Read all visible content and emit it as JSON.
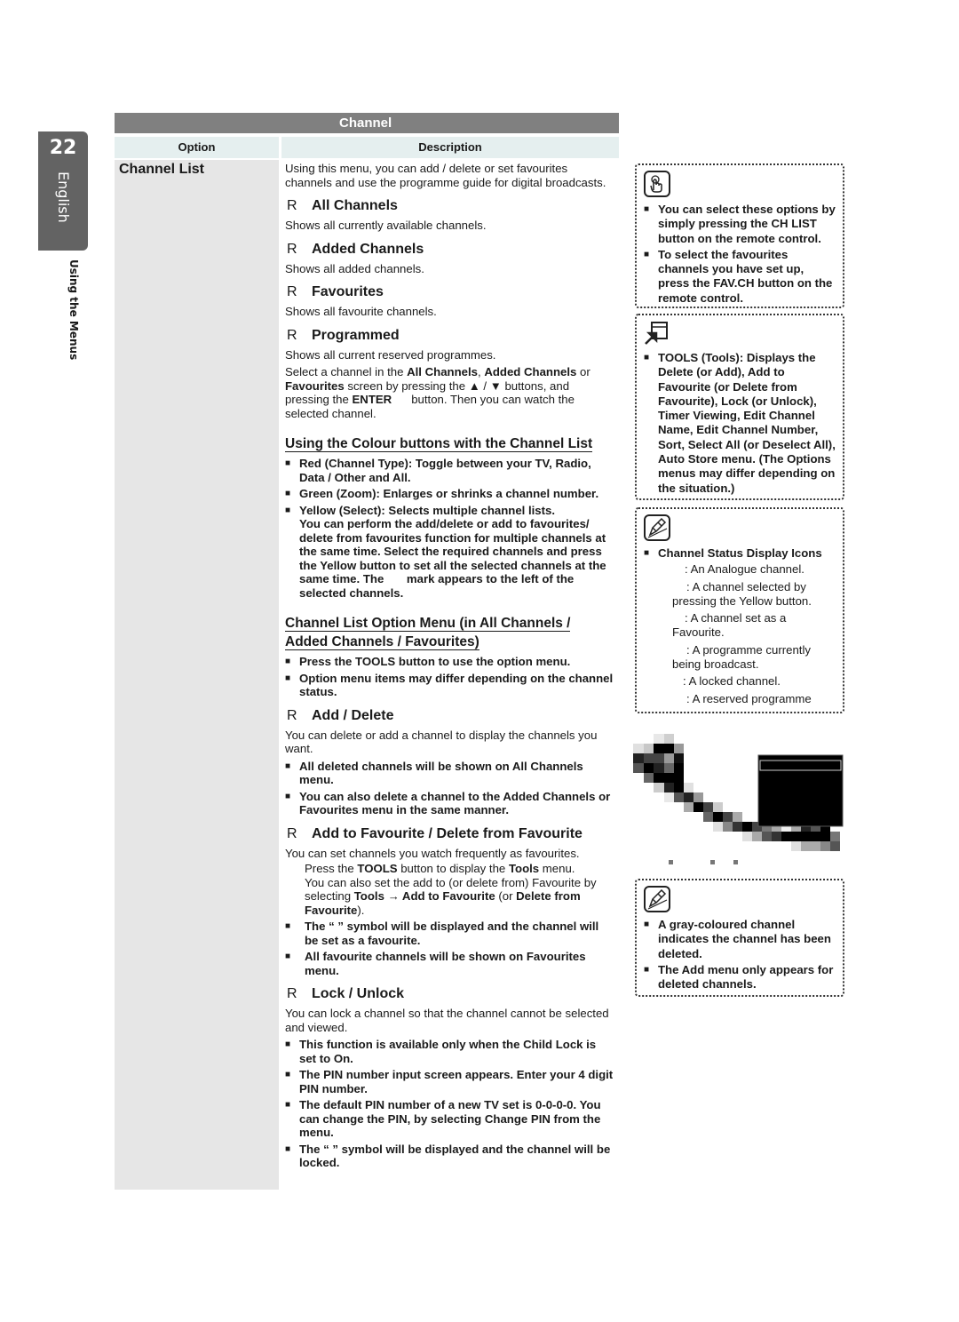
{
  "side_tab": {
    "page_number": "22",
    "language": "English",
    "section": "Using the Menus"
  },
  "table": {
    "title": "Channel",
    "header_option": "Option",
    "header_description": "Description",
    "option_name": "Channel List"
  },
  "desc": {
    "intro": "Using this menu, you can add / delete or set favourites channels and use the programme guide for digital broadcasts.",
    "marker": "R",
    "all_channels": {
      "title": "All Channels",
      "text": "Shows all currently available channels."
    },
    "added_channels": {
      "title": "Added Channels",
      "text": "Shows all added channels."
    },
    "favourites": {
      "title": "Favourites",
      "text": "Shows all favourite channels."
    },
    "programmed": {
      "title": "Programmed",
      "text": "Shows all current reserved programmes.",
      "select_a": "Select a channel in the ",
      "select_b1": "All Channels",
      "select_c": ", ",
      "select_b2": "Added Channels",
      "select_d": " or ",
      "select_b3": "Favourites",
      "select_e": " screen by pressing the ▲ / ▼ buttons, and pressing the ",
      "select_b4": "ENTER",
      "select_f": "      button. Then you can watch the selected channel."
    },
    "colour_heading": "Using the Colour buttons with the Channel List",
    "colour_items": {
      "red_a": "Red (",
      "red_b": "Channel Type",
      "red_c": "): Toggle between your ",
      "red_d": "TV",
      "red_e": ", ",
      "red_f": "Radio",
      "red_g": ", ",
      "red_h": "Data / Other",
      "red_i": " and ",
      "red_j": "All",
      "red_k": ".",
      "green_a": "Green (",
      "green_b": "Zoom",
      "green_c": "): Enlarges or shrinks a channel number.",
      "yellow_a": "Yellow (",
      "yellow_b": "Select",
      "yellow_c": "): Selects multiple channel lists.",
      "yellow_d": "You can perform the add/delete or add to favourites/ delete from favourites function for multiple channels at the same time. Select the required channels and press the Yellow button to set all the selected channels at the same time. The       mark appears to the left of the selected channels."
    },
    "option_menu_heading_1": "Channel List Option Menu (in All Channels /",
    "option_menu_heading_2": "Added Channels / Favourites)",
    "option_menu_items": {
      "tools_a": "Press the ",
      "tools_b": "TOOLS",
      "tools_c": " button to use the option menu.",
      "differ": "Option menu items may differ depending on the channel status."
    },
    "add_delete": {
      "title": "Add / Delete",
      "text": "You can delete or add a channel to display the channels you want.",
      "item1_a": "All deleted channels will be shown on ",
      "item1_b": "All Channels",
      "item1_c": " menu.",
      "item2_a": "You can also delete a channel to the ",
      "item2_b": "Added Channels",
      "item2_c": " or ",
      "item2_d": "Favourites",
      "item2_e": " menu in the same manner."
    },
    "add_fav": {
      "title": "Add to Favourite / Delete from Favourite",
      "text": "You can set channels you watch frequently as favourites.",
      "ind_a": "Press the ",
      "ind_b": "TOOLS",
      "ind_c": " button to display the ",
      "ind_d": "Tools",
      "ind_e": " menu.",
      "ind2_a": "You can also set the add to (or delete from) Favourite by selecting ",
      "ind2_b": "Tools → Add to Favourite",
      "ind2_c": " (or ",
      "ind2_d": "Delete from Favourite",
      "ind2_e": ").",
      "item1": "The “    ” symbol will be displayed and the channel will be set as a favourite.",
      "item2_a": "All favourite channels will be shown on ",
      "item2_b": "Favourites",
      "item2_c": " menu."
    },
    "lock": {
      "title": "Lock / Unlock",
      "text": "You can lock a channel so that the channel cannot be selected and viewed.",
      "item1_a": "This function is available only when the ",
      "item1_b": "Child Lock",
      "item1_c": " is set to ",
      "item1_d": "On",
      "item1_e": ".",
      "item2": "The PIN number input screen appears. Enter your 4 digit PIN number.",
      "item3_a": "The default PIN number of a new TV set is ",
      "item3_b": "0-0-0-0",
      "item3_c": ". You can change the PIN, by selecting ",
      "item3_d": "Change PIN",
      "item3_e": " from the menu.",
      "item4": "The “    ” symbol will be displayed and the channel will be locked."
    }
  },
  "notes": {
    "remote": {
      "item1_a": "You can select these options by simply pressing the ",
      "item1_b": "CH LIST",
      "item1_c": " button on the remote control.",
      "item2_a": "To select the favourites channels you have set up, press the ",
      "item2_b": "FAV.CH",
      "item2_c": " button on the remote control."
    },
    "tools": {
      "a": "TOOLS (Tools)",
      "b": ": Displays the ",
      "c": "Delete",
      "d": " (or ",
      "e": "Add",
      "f": "), ",
      "g": "Add to Favourite",
      "h": " (or ",
      "i": "Delete from Favourite",
      "j": "), ",
      "k": "Lock",
      "l": " (or ",
      "m": "Unlock",
      "n": "), ",
      "o": "Timer Viewing",
      "p": ", ",
      "q": "Edit Channel Name",
      "r": ", ",
      "s": "Edit Channel Number",
      "t": ", ",
      "u": "Sort",
      "v": ", ",
      "w": "Select All",
      "x": " (or ",
      "y": "Deselect All",
      "z": "), ",
      "aa": "Auto Store",
      "ab": " menu. (The Options menus may differ depending on the situation.)"
    },
    "status": {
      "heading": "Channel Status Display Icons",
      "items": [
        ": An Analogue channel.",
        ": A channel selected by pressing the Yellow button.",
        ": A channel set as a Favourite.",
        ": A programme currently being broadcast.",
        ": A locked channel.",
        ": A reserved programme"
      ]
    },
    "deleted": {
      "item1": "A gray-coloured channel indicates the channel has been deleted.",
      "item2_a": "The ",
      "item2_b": "Add",
      "item2_c": " menu only appears for deleted channels."
    }
  }
}
